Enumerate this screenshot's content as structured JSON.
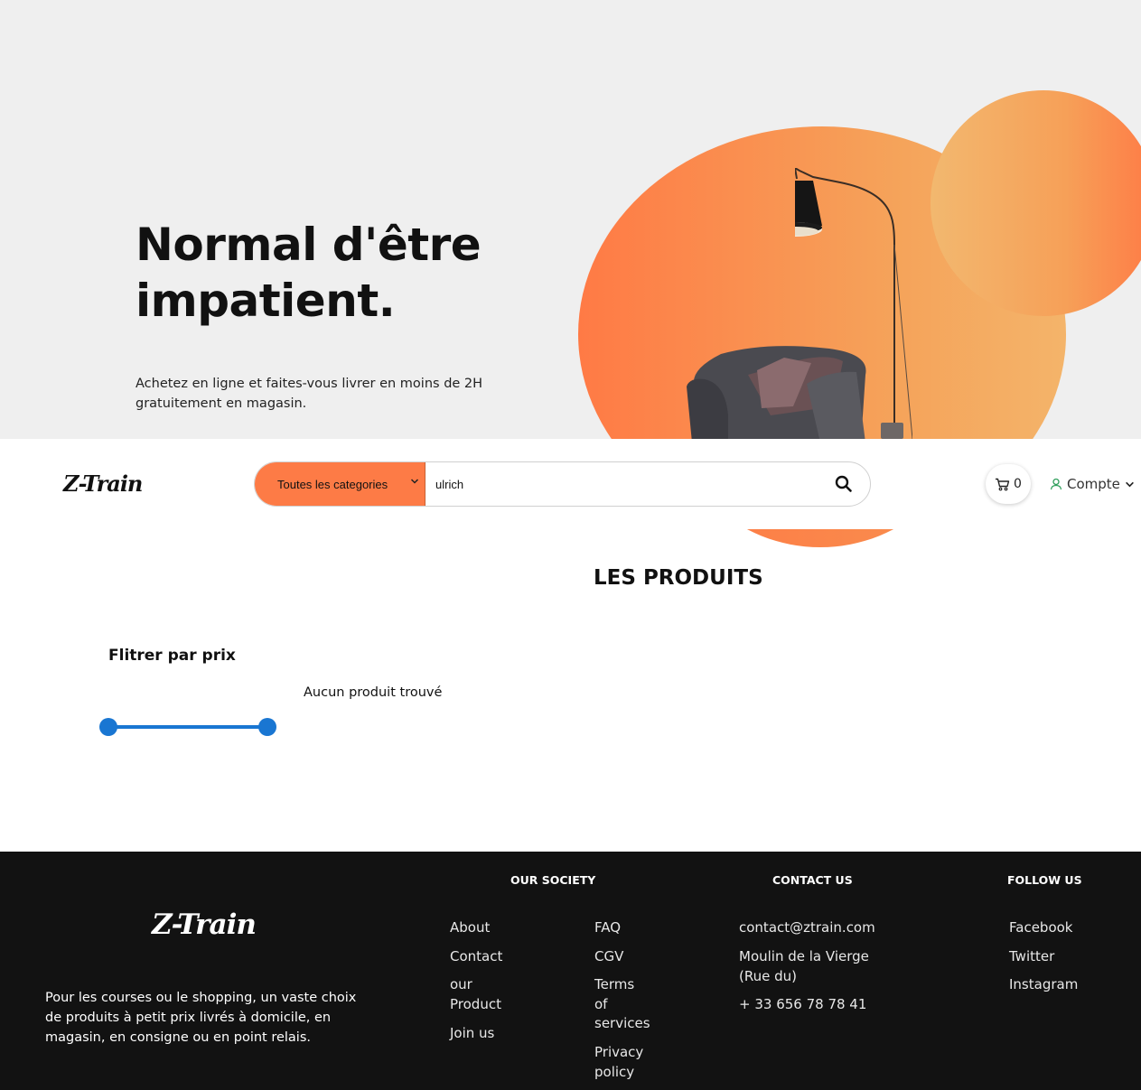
{
  "hero": {
    "title_line1": "Normal d'être",
    "title_line2": "impatient.",
    "subtitle": "Achetez en ligne et faites-vous livrer en moins de 2H gratuitement en magasin."
  },
  "navbar": {
    "logo": "Z-Train",
    "category_select": "Toutes les categories",
    "search_value": "ulrich",
    "cart_count": "0",
    "account_label": "Compte"
  },
  "products": {
    "title": "LES PRODUITS",
    "filter_title": "Flitrer par prix",
    "empty_message": "Aucun produit trouvé",
    "price_range": {
      "min_fraction": 0.0,
      "max_fraction": 1.0
    }
  },
  "footer": {
    "logo": "Z-Train",
    "description": "Pour les courses ou le shopping, un vaste choix de produits à petit prix livrés à domicile, en magasin, en consigne ou en point relais.",
    "our_society": {
      "heading": "OUR SOCIETY",
      "col1": [
        "About",
        "Contact",
        "our",
        "Product",
        "Join us"
      ],
      "col2": [
        "FAQ",
        "CGV",
        "Terms",
        "of",
        "services",
        "Privacy",
        "policy"
      ]
    },
    "contact": {
      "heading": "CONTACT US",
      "email": "contact@ztrain.com",
      "address_line1": "Moulin de la Vierge",
      "address_line2": "(Rue du)",
      "phone": "+ 33 656 78 78 41"
    },
    "follow": {
      "heading": "FOLLOW US",
      "links": [
        "Facebook",
        "Twitter",
        "Instagram"
      ]
    }
  },
  "colors": {
    "accent": "#fd7b46",
    "slider": "#1976d2",
    "footer_bg": "#121212",
    "account_icon": "#2e9e5b"
  }
}
